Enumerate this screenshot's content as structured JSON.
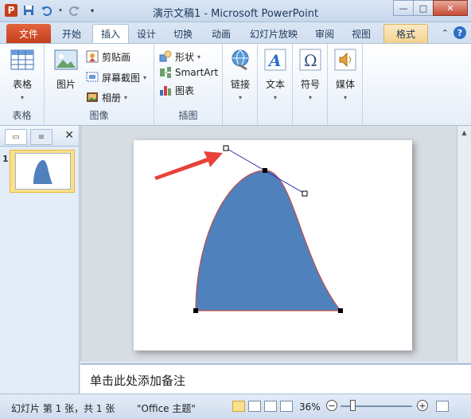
{
  "title": "演示文稿1 - Microsoft PowerPoint",
  "qat": {
    "app_icon": "P"
  },
  "tabs": [
    {
      "label": "文件"
    },
    {
      "label": "开始"
    },
    {
      "label": "插入"
    },
    {
      "label": "设计"
    },
    {
      "label": "切换"
    },
    {
      "label": "动画"
    },
    {
      "label": "幻灯片放映"
    },
    {
      "label": "审阅"
    },
    {
      "label": "视图"
    },
    {
      "label": "格式"
    }
  ],
  "ribbon": {
    "table": {
      "button": "表格",
      "group": "表格"
    },
    "image": {
      "picture": "图片",
      "clipart": "剪贴画",
      "screenshot": "屏幕截图",
      "album": "相册",
      "group": "图像"
    },
    "illustrations": {
      "shapes": "形状",
      "smartart": "SmartArt",
      "chart": "图表",
      "group": "插图"
    },
    "links": {
      "button": "链接"
    },
    "text": {
      "button": "文本"
    },
    "symbols": {
      "button": "符号"
    },
    "media": {
      "button": "媒体"
    }
  },
  "slide_panel": {
    "slide_number": "1"
  },
  "notes": {
    "placeholder": "单击此处添加备注"
  },
  "status": {
    "slide_info": "幻灯片 第 1 张，共 1 张",
    "theme": "\"Office 主题\"",
    "zoom": "36%"
  },
  "colors": {
    "accent_file_tab": "#c43e1c",
    "shape_fill": "#4f81bd",
    "shape_outline": "#c0504d",
    "arrow": "#e8423a",
    "format_tab": "#f3d28e"
  }
}
